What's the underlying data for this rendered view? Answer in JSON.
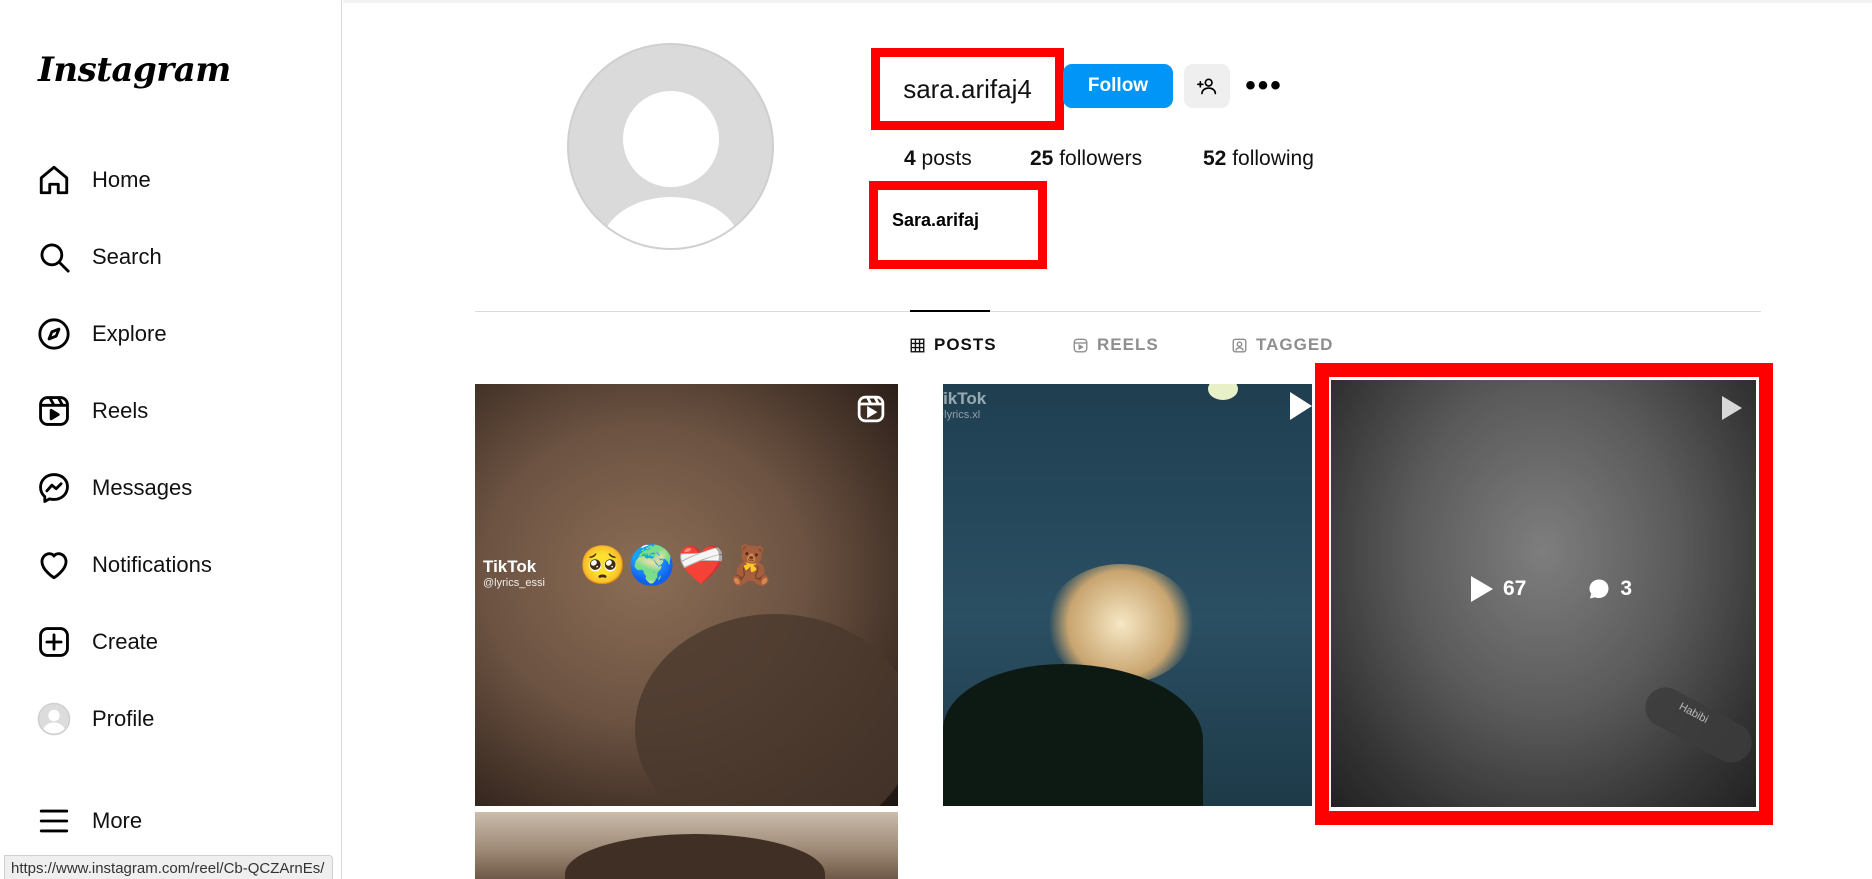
{
  "brand": {
    "logo": "Instagram"
  },
  "sidebar": {
    "items": [
      {
        "label": "Home",
        "icon": "home-icon"
      },
      {
        "label": "Search",
        "icon": "search-icon"
      },
      {
        "label": "Explore",
        "icon": "compass-icon"
      },
      {
        "label": "Reels",
        "icon": "reels-icon"
      },
      {
        "label": "Messages",
        "icon": "messenger-icon"
      },
      {
        "label": "Notifications",
        "icon": "heart-icon"
      },
      {
        "label": "Create",
        "icon": "plus-square-icon"
      },
      {
        "label": "Profile",
        "icon": "avatar-icon"
      },
      {
        "label": "More",
        "icon": "menu-icon"
      }
    ]
  },
  "status_bar": {
    "url": "https://www.instagram.com/reel/Cb-QCZArnEs/"
  },
  "profile": {
    "username": "sara.arifaj4",
    "follow_label": "Follow",
    "full_name": "Sara.arifaj",
    "stats": {
      "posts_count": "4",
      "posts_label": "posts",
      "followers_count": "25",
      "followers_label": "followers",
      "following_count": "52",
      "following_label": "following"
    }
  },
  "tabs": [
    {
      "label": "POSTS",
      "active": true,
      "icon": "grid-icon"
    },
    {
      "label": "REELS",
      "active": false,
      "icon": "reels-icon"
    },
    {
      "label": "TAGGED",
      "active": false,
      "icon": "tagged-icon"
    }
  ],
  "posts": [
    {
      "tiktok_brand": "TikTok",
      "tiktok_handle": "@lyrics_essi",
      "emojis": "🥺🌍❤️‍🩹🧸",
      "type_icon": "reel-icon"
    },
    {
      "tiktok_brand": "TikTok",
      "tiktok_handle": "@lyrics.xl",
      "type_icon": "play-icon"
    },
    {
      "views": "67",
      "comments": "3",
      "type_icon": "play-icon",
      "music_tag": "Habibi"
    },
    {}
  ],
  "colors": {
    "follow_button": "#0095f6",
    "highlight": "#ff0000"
  }
}
